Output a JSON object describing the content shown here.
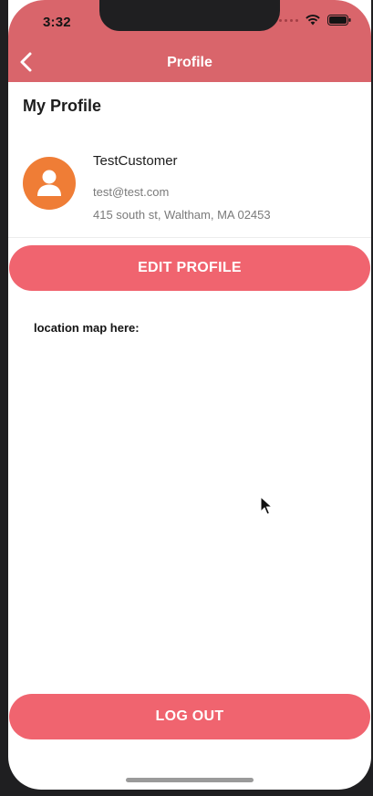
{
  "status_bar": {
    "time": "3:32",
    "icons": [
      "signal-dots-icon",
      "wifi-icon",
      "battery-icon"
    ]
  },
  "header": {
    "title": "Profile",
    "back_icon": "chevron-left-icon",
    "color": "#d9656b"
  },
  "profile": {
    "section_title": "My Profile",
    "avatar_icon": "user-icon",
    "avatar_color": "#ef7d36",
    "name": "TestCustomer",
    "email": "test@test.com",
    "address": "415 south st, Waltham, MA 02453"
  },
  "actions": {
    "edit_label": "EDIT PROFILE",
    "logout_label": "LOG OUT",
    "button_color": "#f0646f"
  },
  "map": {
    "label": "location map here:"
  }
}
